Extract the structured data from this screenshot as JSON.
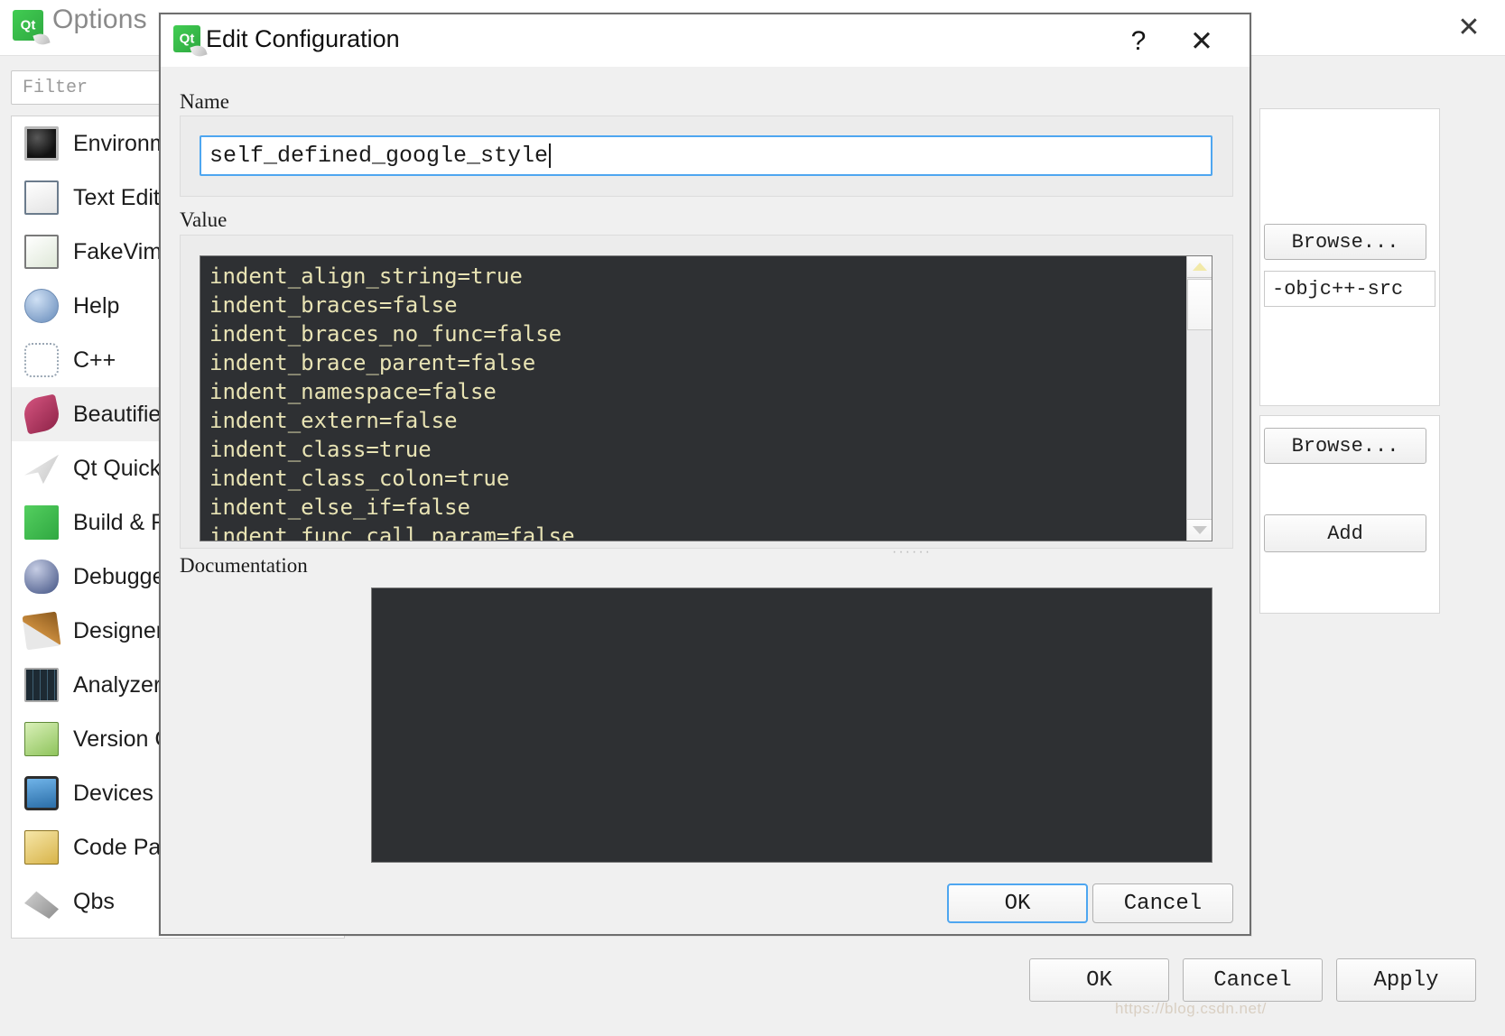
{
  "options_window": {
    "title": "Options",
    "title_icon": "qt-logo-icon",
    "close_label": "✕",
    "filter": {
      "placeholder": "Filter",
      "value": ""
    },
    "sidebar": {
      "items": [
        {
          "label": "Environment",
          "icon": "environment-icon",
          "selected": false
        },
        {
          "label": "Text Editor",
          "icon": "text-editor-icon",
          "selected": false
        },
        {
          "label": "FakeVim",
          "icon": "fakevim-icon",
          "selected": false
        },
        {
          "label": "Help",
          "icon": "help-icon",
          "selected": false
        },
        {
          "label": "C++",
          "icon": "cpp-icon",
          "selected": false
        },
        {
          "label": "Beautifier",
          "icon": "beautifier-icon",
          "selected": true
        },
        {
          "label": "Qt Quick",
          "icon": "qt-quick-icon",
          "selected": false
        },
        {
          "label": "Build & Run",
          "icon": "build-and-run-icon",
          "selected": false
        },
        {
          "label": "Debugger",
          "icon": "debugger-icon",
          "selected": false
        },
        {
          "label": "Designer",
          "icon": "designer-icon",
          "selected": false
        },
        {
          "label": "Analyzer",
          "icon": "analyzer-icon",
          "selected": false
        },
        {
          "label": "Version Control",
          "icon": "version-control-icon",
          "selected": false
        },
        {
          "label": "Devices",
          "icon": "devices-icon",
          "selected": false
        },
        {
          "label": "Code Pasting",
          "icon": "code-pasting-icon",
          "selected": false
        },
        {
          "label": "Qbs",
          "icon": "qbs-icon",
          "selected": false
        }
      ]
    },
    "background_widgets": {
      "browse_1": "Browse...",
      "objc_field": "-objc++-src",
      "browse_2": "Browse...",
      "add_button": "Add"
    },
    "bottom_buttons": {
      "ok": "OK",
      "cancel": "Cancel",
      "apply": "Apply"
    },
    "watermark": "https://blog.csdn.net/"
  },
  "edit_dialog": {
    "title": "Edit Configuration",
    "title_icon": "qt-logo-icon",
    "help_label": "?",
    "close_label": "✕",
    "name": {
      "label": "Name",
      "value": "self_defined_google_style"
    },
    "value": {
      "label": "Value",
      "lines": [
        "indent_align_string=true",
        "indent_braces=false",
        "indent_braces_no_func=false",
        "indent_brace_parent=false",
        "indent_namespace=false",
        "indent_extern=false",
        "indent_class=true",
        "indent_class_colon=true",
        "indent_else_if=false",
        "indent_func_call_param=false"
      ],
      "scrollbar": {
        "up_arrow": "scroll-up-arrow",
        "down_arrow": "scroll-down-arrow"
      },
      "resize_grip": "······"
    },
    "documentation": {
      "label": "Documentation",
      "content": ""
    },
    "buttons": {
      "ok": "OK",
      "cancel": "Cancel"
    }
  },
  "colors": {
    "accent_blue": "#4ea6f0",
    "editor_background": "#2e3033",
    "editor_text": "#e8e3b4",
    "dialog_background": "#f0f0f0",
    "qt_green": "#41cd52"
  }
}
